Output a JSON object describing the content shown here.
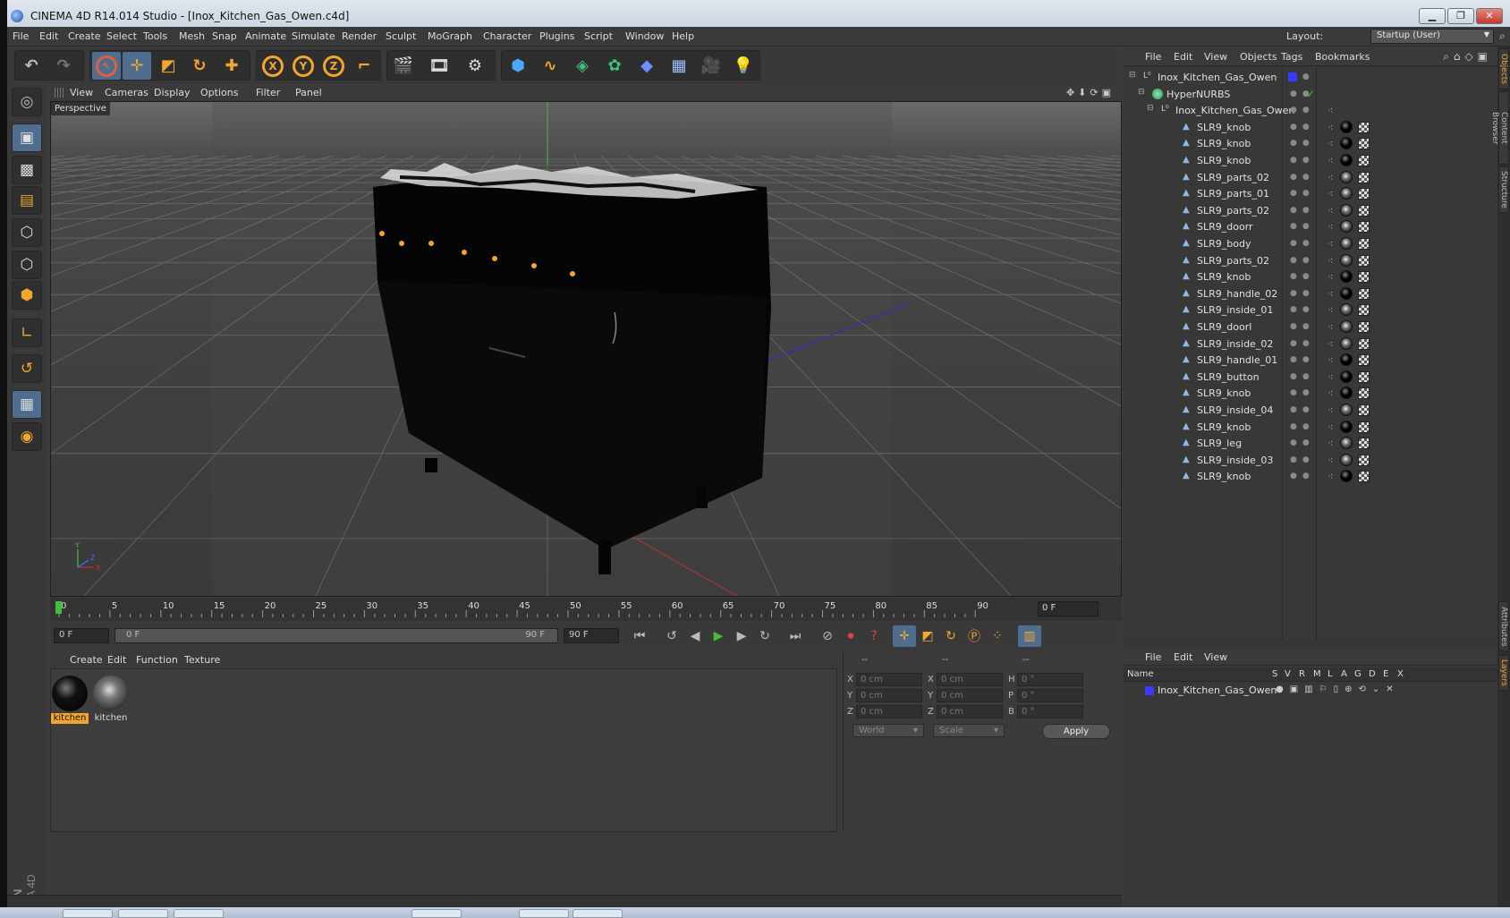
{
  "window": {
    "title": "CINEMA 4D R14.014 Studio - [Inox_Kitchen_Gas_Owen.c4d]"
  },
  "menubar": [
    "File",
    "Edit",
    "Create",
    "Select",
    "Tools",
    "Mesh",
    "Snap",
    "Animate",
    "Simulate",
    "Render",
    "Sculpt",
    "MoGraph",
    "Character",
    "Plugins",
    "Script",
    "Window",
    "Help"
  ],
  "layout": {
    "label": "Layout:",
    "value": "Startup (User)"
  },
  "viewport": {
    "menu": [
      "View",
      "Cameras",
      "Display",
      "Options",
      "Filter",
      "Panel"
    ],
    "label": "Perspective",
    "axis": {
      "x": "X",
      "y": "Y",
      "z": "Z"
    }
  },
  "timeline": {
    "ticks": [
      "0",
      "5",
      "10",
      "15",
      "20",
      "25",
      "30",
      "35",
      "40",
      "45",
      "50",
      "55",
      "60",
      "65",
      "70",
      "75",
      "80",
      "85",
      "90"
    ],
    "current_frame": "0 F"
  },
  "transport": {
    "start": "0 F",
    "range_start": "0 F",
    "range_end": "90 F",
    "end": "90 F"
  },
  "material_manager": {
    "menu": [
      "Create",
      "Edit",
      "Function",
      "Texture"
    ],
    "materials": [
      {
        "name": "kitchen",
        "style": "dark"
      },
      {
        "name": "kitchen",
        "style": "chrome"
      }
    ]
  },
  "coordinates": {
    "headers": [
      "--",
      "--",
      "--"
    ],
    "rows": [
      {
        "a": "X",
        "av": "0 cm",
        "b": "X",
        "bv": "0 cm",
        "c": "H",
        "cv": "0 °"
      },
      {
        "a": "Y",
        "av": "0 cm",
        "b": "Y",
        "bv": "0 cm",
        "c": "P",
        "cv": "0 °"
      },
      {
        "a": "Z",
        "av": "0 cm",
        "b": "Z",
        "bv": "0 cm",
        "c": "B",
        "cv": "0 °"
      }
    ],
    "mode": "World",
    "type": "Scale",
    "apply": "Apply"
  },
  "object_manager": {
    "menu": [
      "File",
      "Edit",
      "View",
      "Objects",
      "Tags",
      "Bookmarks"
    ],
    "objects": [
      {
        "name": "Inox_Kitchen_Gas_Owen",
        "indent": 0,
        "kind": "null",
        "tags": "none"
      },
      {
        "name": "HyperNURBS",
        "indent": 1,
        "kind": "nurbs",
        "tags": "none"
      },
      {
        "name": "Inox_Kitchen_Gas_Owen",
        "indent": 2,
        "kind": "null",
        "tags": "none"
      },
      {
        "name": "SLR9_knob",
        "indent": 3,
        "kind": "poly",
        "tags": "dark"
      },
      {
        "name": "SLR9_knob",
        "indent": 3,
        "kind": "poly",
        "tags": "dark"
      },
      {
        "name": "SLR9_knob",
        "indent": 3,
        "kind": "poly",
        "tags": "dark"
      },
      {
        "name": "SLR9_parts_02",
        "indent": 3,
        "kind": "poly",
        "tags": "chrome"
      },
      {
        "name": "SLR9_parts_01",
        "indent": 3,
        "kind": "poly",
        "tags": "chrome"
      },
      {
        "name": "SLR9_parts_02",
        "indent": 3,
        "kind": "poly",
        "tags": "chrome"
      },
      {
        "name": "SLR9_doorr",
        "indent": 3,
        "kind": "poly",
        "tags": "chrome"
      },
      {
        "name": "SLR9_body",
        "indent": 3,
        "kind": "poly",
        "tags": "chrome"
      },
      {
        "name": "SLR9_parts_02",
        "indent": 3,
        "kind": "poly",
        "tags": "chrome"
      },
      {
        "name": "SLR9_knob",
        "indent": 3,
        "kind": "poly",
        "tags": "dark"
      },
      {
        "name": "SLR9_handle_02",
        "indent": 3,
        "kind": "poly",
        "tags": "dark"
      },
      {
        "name": "SLR9_inside_01",
        "indent": 3,
        "kind": "poly",
        "tags": "chrome"
      },
      {
        "name": "SLR9_doorl",
        "indent": 3,
        "kind": "poly",
        "tags": "chrome"
      },
      {
        "name": "SLR9_inside_02",
        "indent": 3,
        "kind": "poly",
        "tags": "chrome"
      },
      {
        "name": "SLR9_handle_01",
        "indent": 3,
        "kind": "poly",
        "tags": "dark"
      },
      {
        "name": "SLR9_button",
        "indent": 3,
        "kind": "poly",
        "tags": "dark"
      },
      {
        "name": "SLR9_knob",
        "indent": 3,
        "kind": "poly",
        "tags": "dark"
      },
      {
        "name": "SLR9_inside_04",
        "indent": 3,
        "kind": "poly",
        "tags": "chrome"
      },
      {
        "name": "SLR9_knob",
        "indent": 3,
        "kind": "poly",
        "tags": "dark"
      },
      {
        "name": "SLR9_leg",
        "indent": 3,
        "kind": "poly",
        "tags": "chrome"
      },
      {
        "name": "SLR9_inside_03",
        "indent": 3,
        "kind": "poly",
        "tags": "chrome"
      },
      {
        "name": "SLR9_knob",
        "indent": 3,
        "kind": "poly",
        "tags": "dark"
      }
    ]
  },
  "layer_manager": {
    "menu": [
      "File",
      "Edit",
      "View"
    ],
    "columns": [
      "Name",
      "S",
      "V",
      "R",
      "M",
      "L",
      "A",
      "G",
      "D",
      "E",
      "X"
    ],
    "layers": [
      {
        "name": "Inox_Kitchen_Gas_Owen",
        "color": "#3a3aff"
      }
    ]
  },
  "side_tabs": [
    "Objects",
    "Content Browser",
    "Structure",
    "Attributes",
    "Layers"
  ],
  "brand": {
    "line1": "MAXON",
    "line2": "CINEMA 4D"
  },
  "colors": {
    "accent": "#f3a52d",
    "selection": "#4f6d8f",
    "panel": "#3b3b3b"
  },
  "icons": {
    "toolbar": [
      "undo-icon",
      "redo-icon",
      "live-select-icon",
      "move-icon",
      "scale-icon",
      "rotate-icon",
      "create-object-icon",
      "x-axis-icon",
      "y-axis-icon",
      "z-axis-icon",
      "coordinate-system-icon",
      "render-view-icon",
      "render-picture-viewer-icon",
      "render-settings-icon",
      "cube-icon",
      "spline-icon",
      "nurbs-icon",
      "array-icon",
      "deformer-icon",
      "environment-icon",
      "camera-icon",
      "light-icon"
    ],
    "left": [
      "make-editable-icon",
      "model-mode-icon",
      "texture-mode-icon",
      "workplane-icon",
      "points-mode-icon",
      "edges-mode-icon",
      "polygons-mode-icon",
      "axis-mode-icon",
      "tweak-mode-icon",
      "snap-icon",
      "locked-workplane-icon"
    ]
  }
}
